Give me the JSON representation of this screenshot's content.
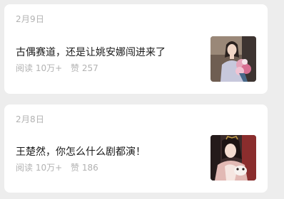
{
  "articles": [
    {
      "date": "2月9日",
      "title": "古偶赛道，还是让姚安娜闯进来了",
      "read_label": "阅读",
      "read_count": "10万+",
      "like_label": "赞",
      "like_count": "257",
      "thumbnail": "photo-woman-holding-bouquet"
    },
    {
      "date": "2月8日",
      "title": "王楚然，你怎么什么剧都演！",
      "read_label": "阅读",
      "read_count": "10万+",
      "like_label": "赞",
      "like_count": "186",
      "thumbnail": "photo-woman-costume-drama"
    }
  ],
  "colors": {
    "page_bg": "#ededed",
    "card_bg": "#ffffff",
    "title_text": "#191919",
    "secondary_text": "#b2b2b2"
  }
}
